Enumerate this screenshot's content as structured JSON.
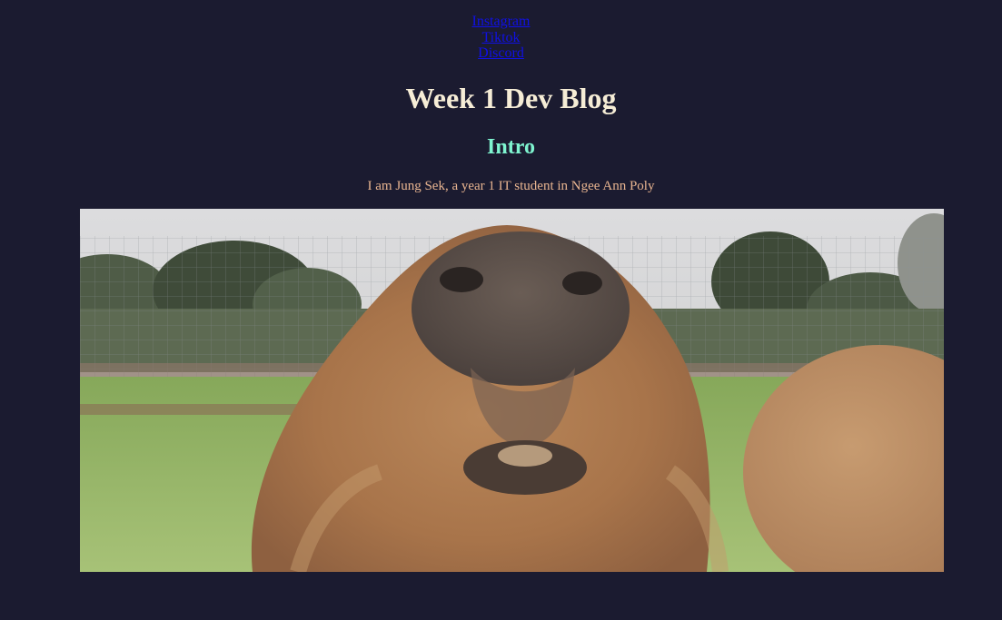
{
  "nav": {
    "links": [
      "Instagram",
      "Tiktok",
      "Discord"
    ]
  },
  "page_title": "Week 1 Dev Blog",
  "intro": {
    "heading": "Intro",
    "text": "I am Jung Sek, a year 1 IT student in Ngee Ann Poly"
  },
  "photo": {
    "subject": "capybara close-up"
  },
  "colors": {
    "background": "#1b1b30",
    "title": "#f6edd6",
    "intro_heading": "#7ff5d0",
    "intro_text": "#e9b590",
    "link": "#1010e6"
  }
}
